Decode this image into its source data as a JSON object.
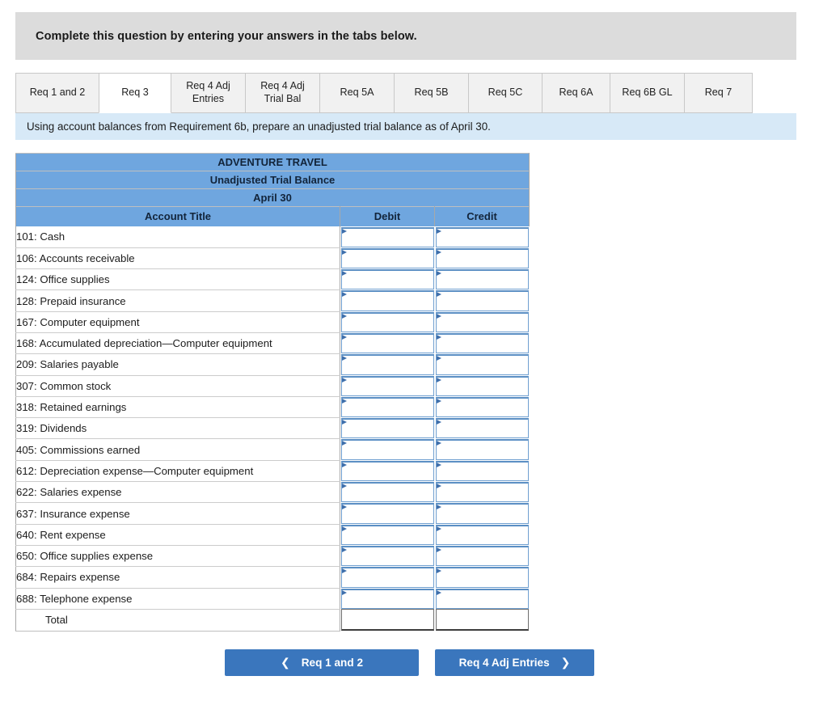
{
  "banner": {
    "text": "Complete this question by entering your answers in the tabs below."
  },
  "tabs": {
    "active_index": 1,
    "items": [
      {
        "label": "Req 1 and 2"
      },
      {
        "label": "Req 3"
      },
      {
        "label": "Req 4 Adj\nEntries",
        "line1": "Req 4 Adj",
        "line2": "Entries"
      },
      {
        "label": "Req 4 Adj\nTrial Bal",
        "line1": "Req 4 Adj",
        "line2": "Trial Bal"
      },
      {
        "label": "Req 5A"
      },
      {
        "label": "Req 5B"
      },
      {
        "label": "Req 5C"
      },
      {
        "label": "Req 6A"
      },
      {
        "label": "Req 6B GL"
      },
      {
        "label": "Req 7"
      }
    ]
  },
  "requirement": {
    "text": "Using account balances from Requirement 6b, prepare an unadjusted trial balance as of April 30."
  },
  "trial_balance": {
    "company": "ADVENTURE TRAVEL",
    "statement": "Unadjusted Trial Balance",
    "date": "April 30",
    "columns": {
      "account": "Account Title",
      "debit": "Debit",
      "credit": "Credit"
    },
    "rows": [
      {
        "account": "101: Cash",
        "debit": "",
        "credit": ""
      },
      {
        "account": "106: Accounts receivable",
        "debit": "",
        "credit": ""
      },
      {
        "account": "124: Office supplies",
        "debit": "",
        "credit": ""
      },
      {
        "account": "128: Prepaid insurance",
        "debit": "",
        "credit": ""
      },
      {
        "account": "167: Computer equipment",
        "debit": "",
        "credit": ""
      },
      {
        "account": "168: Accumulated depreciation—Computer equipment",
        "debit": "",
        "credit": ""
      },
      {
        "account": "209: Salaries payable",
        "debit": "",
        "credit": ""
      },
      {
        "account": "307: Common stock",
        "debit": "",
        "credit": ""
      },
      {
        "account": "318: Retained earnings",
        "debit": "",
        "credit": ""
      },
      {
        "account": "319: Dividends",
        "debit": "",
        "credit": ""
      },
      {
        "account": "405: Commissions earned",
        "debit": "",
        "credit": ""
      },
      {
        "account": "612: Depreciation expense—Computer equipment",
        "debit": "",
        "credit": ""
      },
      {
        "account": "622: Salaries expense",
        "debit": "",
        "credit": ""
      },
      {
        "account": "637: Insurance expense",
        "debit": "",
        "credit": ""
      },
      {
        "account": "640: Rent expense",
        "debit": "",
        "credit": ""
      },
      {
        "account": "650: Office supplies expense",
        "debit": "",
        "credit": ""
      },
      {
        "account": "684: Repairs expense",
        "debit": "",
        "credit": ""
      },
      {
        "account": "688: Telephone expense",
        "debit": "",
        "credit": ""
      }
    ],
    "total_row": {
      "account": "Total",
      "debit": "",
      "credit": ""
    }
  },
  "nav": {
    "prev_label": "Req 1 and 2",
    "prev_icon": "chevron-left-icon",
    "next_label": "Req 4 Adj Entries",
    "next_icon": "chevron-right-icon"
  },
  "colors": {
    "banner_bg": "#dcdcdc",
    "requirement_bg": "#d7e9f7",
    "table_header_bg": "#6fa6df",
    "button_bg": "#3a76bd",
    "input_border": "#6f9fd0",
    "input_marker": "#3f6fab"
  }
}
